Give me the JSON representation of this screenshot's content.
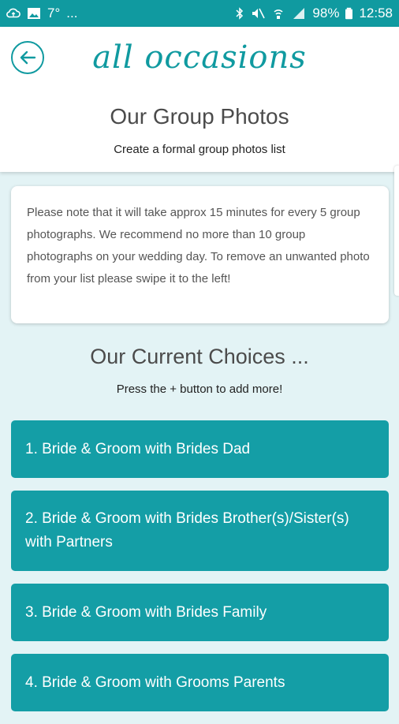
{
  "status_bar": {
    "left_icons": [
      "cloud-upload-icon",
      "image-icon"
    ],
    "temp": "7°",
    "more": "...",
    "battery": "98%",
    "time": "12:58"
  },
  "header": {
    "brand": "all occasions",
    "title": "Our Group Photos",
    "subtitle": "Create a formal group photos list"
  },
  "note": {
    "text": "Please note that it will take approx 15 minutes for every 5 group photographs. We recommend no more than 10 group photographs on your wedding day. To remove an unwanted photo from your list please swipe it to the left!"
  },
  "choices": {
    "title": "Our Current Choices ...",
    "subtitle": "Press the + button to add more!",
    "items": [
      {
        "label": "1. Bride & Groom with Brides Dad"
      },
      {
        "label": "2. Bride & Groom with Brides Brother(s)/Sister(s) with Partners"
      },
      {
        "label": "3. Bride & Groom with Brides Family"
      },
      {
        "label": "4. Bride & Groom with Grooms Parents"
      }
    ]
  },
  "colors": {
    "accent": "#109aa0",
    "item_bg": "#149ea6",
    "background": "#e3f3f5"
  }
}
